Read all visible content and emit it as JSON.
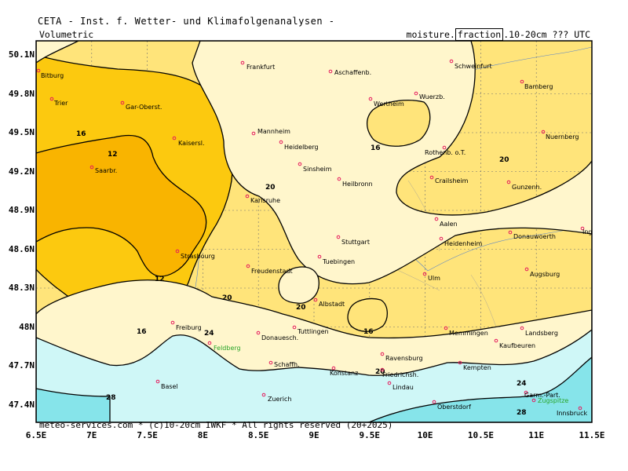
{
  "header": {
    "title": "CETA - Inst. f. Wetter- und Klimafolgenanalysen -",
    "left_label": "Volumetric",
    "right_prefix": "moisture.",
    "right_boxed_1": "fraction",
    "right_suffix": ".10-20cm ??? UTC"
  },
  "footer": {
    "text": "meteo-services.com * (c)10-20cm IWKF * All rights reserved (20+2025)"
  },
  "axes": {
    "lat": [
      "50.1N",
      "49.8N",
      "49.5N",
      "49.2N",
      "48.9N",
      "48.6N",
      "48.3N",
      "48N",
      "47.7N",
      "47.4N"
    ],
    "lon": [
      "6.5E",
      "7E",
      "7.5E",
      "8E",
      "8.5E",
      "9E",
      "9.5E",
      "10E",
      "10.5E",
      "11E",
      "11.5E"
    ]
  },
  "colors": {
    "lt12": "#f9b400",
    "b12_16": "#fcc90f",
    "b16_20": "#ffe47a",
    "b20_24": "#fff6cc",
    "b24_28": "#cff7f7",
    "gt28": "#86e4ea",
    "marker": "#e5195c"
  },
  "contour_labels": [
    "16",
    "12",
    "20",
    "16",
    "20",
    "12",
    "20",
    "16",
    "20",
    "16",
    "24",
    "24",
    "28",
    "20",
    "28"
  ],
  "cities": [
    {
      "name": "Frankfurt"
    },
    {
      "name": "Aschaffenb."
    },
    {
      "name": "Schweinfurt"
    },
    {
      "name": "Bitburg"
    },
    {
      "name": "Trier"
    },
    {
      "name": "Gar-Oberst."
    },
    {
      "name": "Wertheim"
    },
    {
      "name": "Wuerzb."
    },
    {
      "name": "Bamberg"
    },
    {
      "name": "Mannheim"
    },
    {
      "name": "Kaisersl."
    },
    {
      "name": "Heidelberg"
    },
    {
      "name": "Nuernberg"
    },
    {
      "name": "Rothenb. o.T."
    },
    {
      "name": "Saarbr."
    },
    {
      "name": "Sinsheim"
    },
    {
      "name": "Heilbronn"
    },
    {
      "name": "Crailsheim"
    },
    {
      "name": "Gunzenh."
    },
    {
      "name": "Karlsruhe"
    },
    {
      "name": "Aalen"
    },
    {
      "name": "Stuttgart"
    },
    {
      "name": "Heidenheim"
    },
    {
      "name": "Donauwoerth"
    },
    {
      "name": "Ingolstadt"
    },
    {
      "name": "Strasbourg"
    },
    {
      "name": "Tuebingen"
    },
    {
      "name": "Freudenstadt"
    },
    {
      "name": "Ulm"
    },
    {
      "name": "Augsburg"
    },
    {
      "name": "Albstadt"
    },
    {
      "name": "Freiburg"
    },
    {
      "name": "Tuttlingen"
    },
    {
      "name": "Donauesch."
    },
    {
      "name": "Memmingen"
    },
    {
      "name": "Landsberg"
    },
    {
      "name": "Feldberg",
      "green": true
    },
    {
      "name": "Kaufbeuren"
    },
    {
      "name": "Ravensburg"
    },
    {
      "name": "Schaffh."
    },
    {
      "name": "Konstanz"
    },
    {
      "name": "Friedrichsh."
    },
    {
      "name": "Kempten"
    },
    {
      "name": "Lindau"
    },
    {
      "name": "Basel"
    },
    {
      "name": "Garm.-Part."
    },
    {
      "name": "Zugspitze",
      "green": true
    },
    {
      "name": "Zuerich"
    },
    {
      "name": "Oberstdorf"
    },
    {
      "name": "Innsbruck"
    }
  ]
}
